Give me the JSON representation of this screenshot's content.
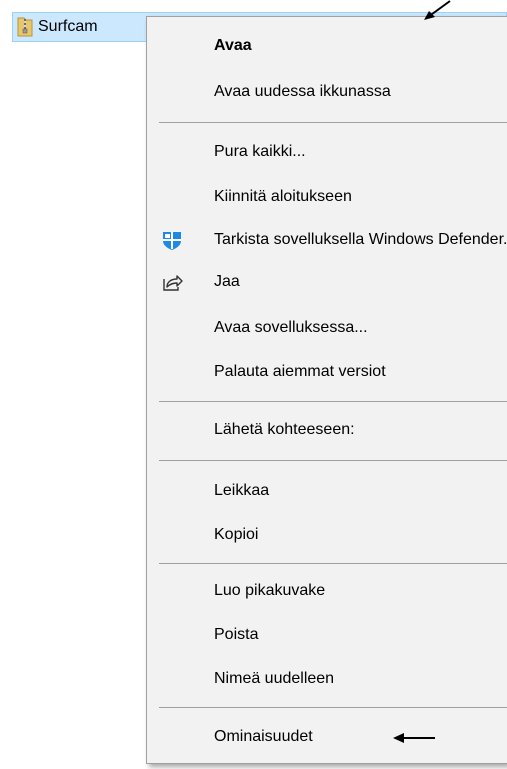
{
  "file": {
    "name": "Surfcam",
    "icon": "zip-folder-icon"
  },
  "context_menu": {
    "items": [
      {
        "label": "Avaa",
        "bold": true
      },
      {
        "label": "Avaa uudessa ikkunassa"
      },
      {
        "label": "Pura kaikki..."
      },
      {
        "label": "Kiinnitä aloitukseen"
      },
      {
        "label": "Tarkista sovelluksella Windows Defender...",
        "icon": "windows-defender-icon"
      },
      {
        "label": "Jaa",
        "icon": "share-icon"
      },
      {
        "label": "Avaa sovelluksessa..."
      },
      {
        "label": "Palauta aiemmat versiot"
      },
      {
        "label": "Lähetä kohteeseen:"
      },
      {
        "label": "Leikkaa"
      },
      {
        "label": "Kopioi"
      },
      {
        "label": "Luo pikakuvake"
      },
      {
        "label": "Poista"
      },
      {
        "label": "Nimeä uudelleen"
      },
      {
        "label": "Ominaisuudet"
      }
    ]
  },
  "colors": {
    "selection_bg": "#cce8ff",
    "selection_border": "#99d1ff",
    "menu_bg": "#f2f2f2",
    "separator": "#a0a0a0",
    "defender_blue": "#1e88e5"
  }
}
